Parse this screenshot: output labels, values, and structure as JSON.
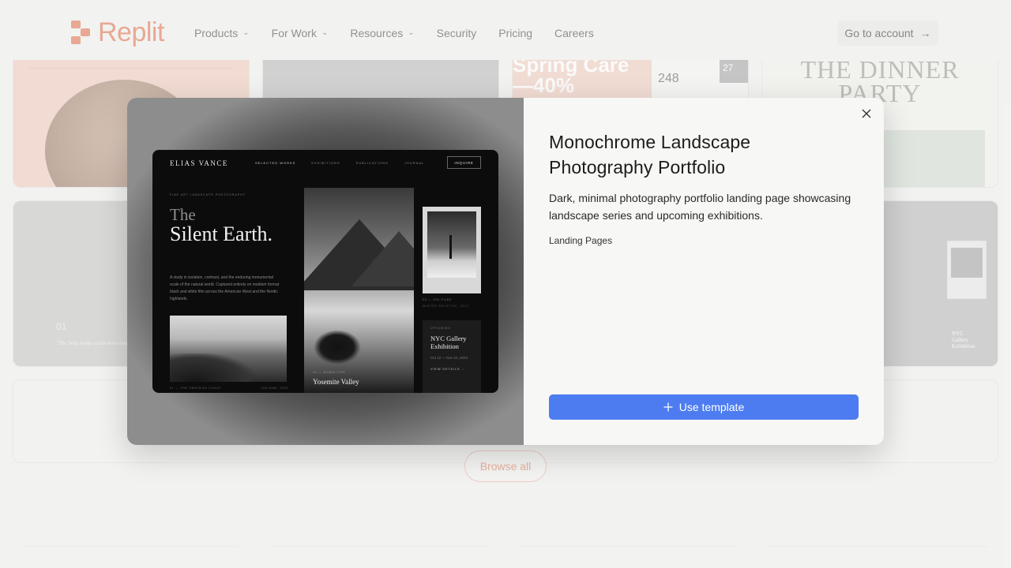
{
  "header": {
    "logo_text": "Replit",
    "brand_color": "#e27b5a",
    "nav": [
      {
        "label": "Products",
        "has_dropdown": true
      },
      {
        "label": "For Work",
        "has_dropdown": true
      },
      {
        "label": "Resources",
        "has_dropdown": true
      },
      {
        "label": "Security",
        "has_dropdown": false
      },
      {
        "label": "Pricing",
        "has_dropdown": false
      },
      {
        "label": "Careers",
        "has_dropdown": false
      }
    ],
    "account_button": "Go to account"
  },
  "background": {
    "promo_text": "Spring Care —40%",
    "stat_248": "248",
    "stat_27": "27",
    "dinner_title": "THE DINNER PARTY",
    "card5_number": "01",
    "card5_quote": "\"The body keeps earth none long after the earth has gone\"",
    "card6_caption": "NYC Gallery Exhibition",
    "browse_button": "Browse all"
  },
  "modal": {
    "title": "Monochrome Landscape Photography Portfolio",
    "description": "Dark, minimal photography portfolio landing page showcasing landscape series and upcoming exhibitions.",
    "category": "Landing Pages",
    "use_button": "Use template",
    "accent_color": "#4d7cf1",
    "preview": {
      "brand": "ELIAS VANCE",
      "nav": [
        "SELECTED WORKS",
        "EXHIBITIONS",
        "PUBLICATIONS",
        "JOURNAL"
      ],
      "inquire": "INQUIRE",
      "kicker": "FINE ART LANDSCAPE PHOTOGRAPHY",
      "headline_prefix": "The",
      "headline": "Silent Earth.",
      "blurb": "A study in isolation, contrast, and the enduring monumental scale of the natural world. Captured entirely on medium format black and white film across the American West and the Nordic highlands.",
      "caption_1": "01 — THE OBSIDIAN COAST",
      "caption_1b": "ICELAND, 2022",
      "caption_2": "02 — MONOLITHS",
      "feature_title": "Yosemite Valley",
      "caption_3": "03 — SOLITUDE",
      "caption_3b": "WINTER SOLSTICE, 2023",
      "event_kicker": "UPCOMING",
      "event_title": "NYC Gallery Exhibition",
      "event_dates": "Oct 12 — Nov 24, 2024",
      "event_link": "VIEW DETAILS →"
    }
  }
}
